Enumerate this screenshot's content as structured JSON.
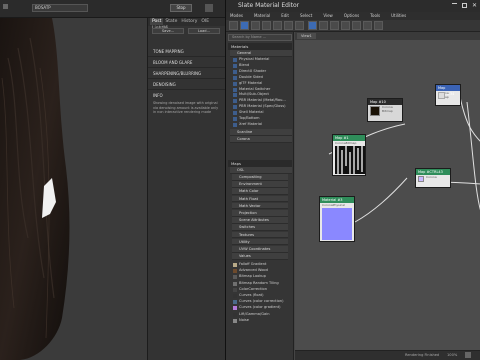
{
  "app": {
    "top_search_value": "BOSATP",
    "stop_label": "Stop"
  },
  "right_panel": {
    "tabs": [
      "Post",
      "State",
      "History",
      "OIE",
      "LightMi"
    ],
    "save_label": "Save...",
    "load_label": "Load...",
    "sections": [
      "TONE MAPPING",
      "BLOOM AND GLARE",
      "SHARPENING/BLURRING",
      "DENOISING"
    ],
    "info_heading": "INFO",
    "info_text": "Showing denoised image with original via denoising amount is available only in non interactive rendering mode"
  },
  "sme": {
    "title": "Slate Material Editor",
    "menu": [
      "Modes",
      "Material",
      "Edit",
      "Select",
      "View",
      "Options",
      "Tools",
      "Utilities"
    ],
    "search_placeholder": "Search by Name ...",
    "view_tab": "View1",
    "materials_header": "Materials",
    "general_group": "General",
    "general_items": [
      "Physical Material",
      "Blend",
      "DirectX Shader",
      "Double Sided",
      "glTF Material",
      "Material Switcher",
      "Multi/Sub-Object",
      "PBR Material (Metal/Rou...",
      "PBR Material (Spec/Gloss)",
      "Shell Material",
      "Top/Bottom",
      "Xref Material"
    ],
    "scanline_group": "Scanline",
    "corona_group": "Corona",
    "maps_header": "Maps",
    "osl_group": "OSL",
    "osl_groups": [
      "Compositing",
      "Environment",
      "Math Color",
      "Math Float",
      "Math Vector",
      "Projection",
      "Scene Attributes",
      "Switches",
      "Textures",
      "Utility",
      "UVW Coordinates",
      "Values"
    ],
    "map_items": [
      "Falloff Gradient",
      "Advanced Wood",
      "Bitmap Lookup",
      "Bitmap Random Tiling",
      "ColorCorrection",
      "Curves (float)",
      "Curves (color correction)",
      "Curves (color gradient)",
      "Lift/Gamma/Gain",
      "Noise"
    ],
    "nodes": {
      "a": {
        "title": "Map #CTRL34",
        "sub": "Corona Bitmap"
      },
      "b": {
        "title": "Map #10",
        "sub": "Corona Bitmap"
      },
      "c": {
        "title": "Map #1",
        "sub": "CoronaBitmap"
      },
      "d": {
        "title": "Map #CTRL43",
        "sub": "Corona"
      },
      "e": {
        "title": "Material #3",
        "sub": "CoronaPhysical"
      }
    },
    "status_text": "Rendering Finished",
    "zoom": "100%"
  },
  "colors": {
    "accent_blue": "#3d6bb3",
    "node_green": "#2f8d5a",
    "node_blue": "#3b63b5",
    "node_purple": "#8a7bd8"
  }
}
